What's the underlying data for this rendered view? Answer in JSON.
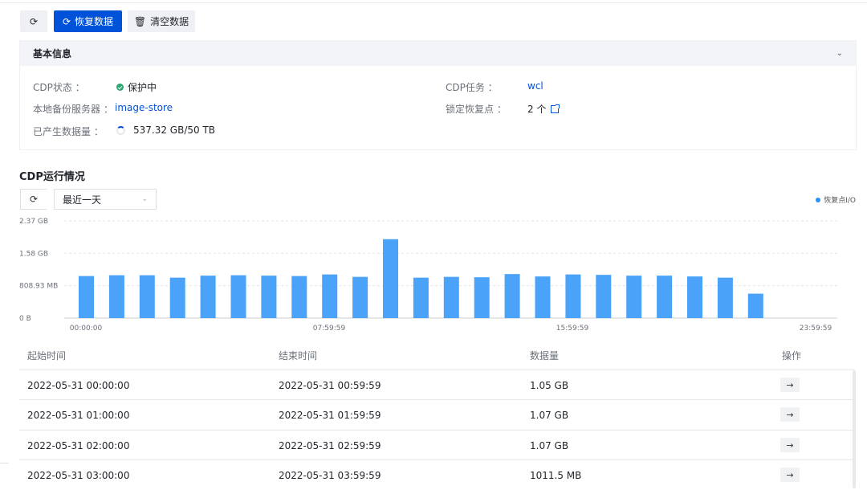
{
  "toolbar": {
    "refresh_icon": "⟳",
    "restore_label": "恢复数据",
    "restore_icon": "⟳",
    "clear_label": "清空数据",
    "clear_icon": "🗑"
  },
  "basic_info": {
    "title": "基本信息",
    "cdp_status_label": "CDP状态 ：",
    "cdp_status_value": "保护中",
    "local_server_label": "本地备份服务器 ：",
    "local_server_value": "image-store",
    "data_generated_label": "已产生数据量 ：",
    "data_generated_value": "537.32 GB/50 TB",
    "cdp_task_label": "CDP任务 ：",
    "cdp_task_value": "wcl",
    "locked_points_label": "锁定恢复点 ：",
    "locked_points_value": "2 个"
  },
  "cdp_run": {
    "title": "CDP运行情况",
    "time_range": "最近一天",
    "legend_label": "恢复点I/O"
  },
  "colors": {
    "primary": "#0052d9",
    "bar": "#4aa3f8",
    "protected": "#2ba471"
  },
  "chart_data": {
    "type": "bar",
    "series": [
      {
        "name": "恢复点I/O",
        "values_mb": [
          1050,
          1070,
          1070,
          1010,
          1060,
          1070,
          1060,
          1050,
          1090,
          1030,
          1970,
          1010,
          1030,
          1020,
          1100,
          1040,
          1090,
          1080,
          1060,
          1060,
          1040,
          1010,
          610
        ]
      }
    ],
    "x_tick_labels": [
      "00:00:00",
      "07:59:59",
      "15:59:59",
      "23:59:59"
    ],
    "y_tick_labels": [
      "0 B",
      "808.93 MB",
      "1.58 GB",
      "2.37 GB"
    ],
    "y_tick_values_mb": [
      0,
      808.93,
      1617.86,
      2426.79
    ],
    "ylim_mb": [
      0,
      2426.79
    ],
    "grid": true
  },
  "table": {
    "headers": [
      "起始时间",
      "结束时间",
      "数据量",
      "操作"
    ],
    "action_icon": "→",
    "rows": [
      [
        "2022-05-31 00:00:00",
        "2022-05-31 00:59:59",
        "1.05 GB"
      ],
      [
        "2022-05-31 01:00:00",
        "2022-05-31 01:59:59",
        "1.07 GB"
      ],
      [
        "2022-05-31 02:00:00",
        "2022-05-31 02:59:59",
        "1.07 GB"
      ],
      [
        "2022-05-31 03:00:00",
        "2022-05-31 03:59:59",
        "1011.5 MB"
      ]
    ]
  }
}
